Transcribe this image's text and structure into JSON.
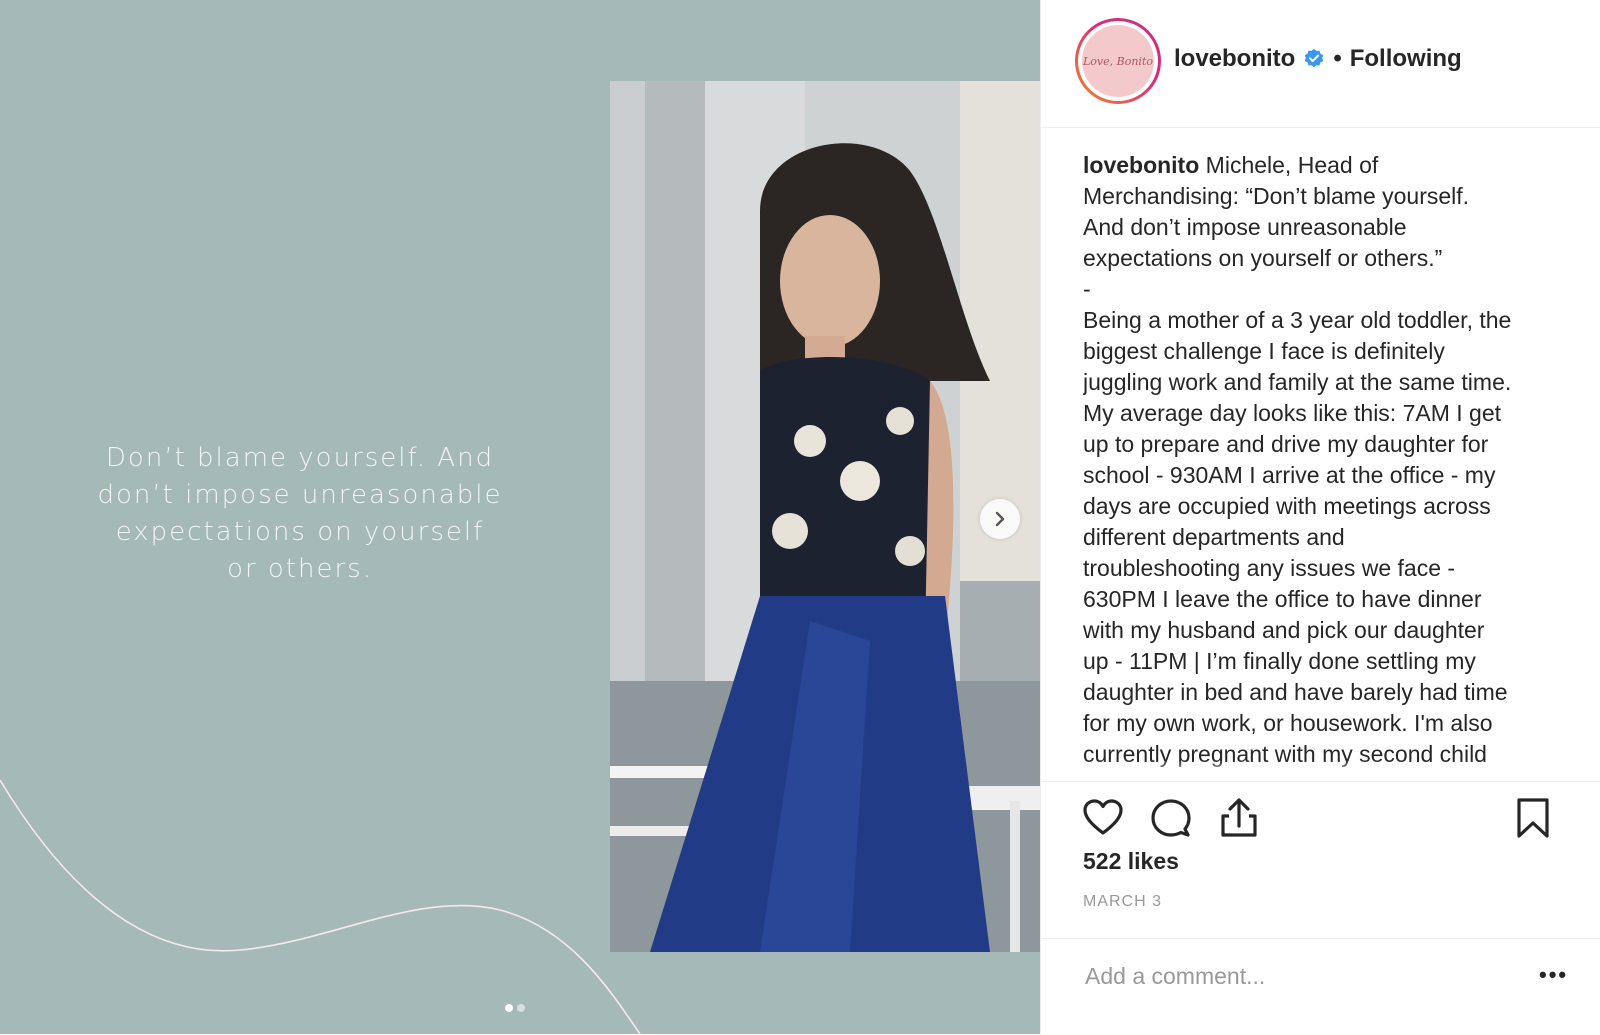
{
  "post": {
    "quote_lines": [
      "Don’t blame yourself. And",
      "don’t impose unreasonable",
      "expectations on yourself",
      "or others."
    ],
    "carousel": {
      "current": 1,
      "total": 2
    }
  },
  "header": {
    "avatar_text": "Love, Bonito",
    "username": "lovebonito",
    "separator": "•",
    "follow_status": "Following"
  },
  "caption": {
    "username": "lovebonito",
    "text": " Michele, Head of\nMerchandising: “Don’t blame yourself.\nAnd don’t impose unreasonable\nexpectations on yourself or others.”\n-\nBeing a mother of a 3 year old toddler, the\nbiggest challenge I face is definitely\njuggling work and family at the same time.\nMy average day looks like this: 7AM I get\nup to prepare and drive my daughter for\nschool - 930AM I arrive at the office - my\ndays are occupied with meetings across\ndifferent departments and\ntroubleshooting any issues we face -\n630PM I leave the office to have dinner\nwith my husband and pick our daughter\nup - 11PM | I’m finally done settling my\ndaughter in bed and have barely had time\nfor my own work, or housework. I'm also\ncurrently pregnant with my second child"
  },
  "stats": {
    "likes": "522 likes",
    "date": "MARCH 3"
  },
  "comment": {
    "placeholder": "Add a comment...",
    "more_label": "•••"
  },
  "icons": {
    "like": "heart-icon",
    "comment": "comment-bubble-icon",
    "share": "share-upload-icon",
    "save": "bookmark-icon",
    "next": "chevron-right-icon",
    "verified": "verified-badge-icon"
  },
  "colors": {
    "background_teal": "#a6b9b9",
    "text_dark": "#262626",
    "text_muted": "#999999",
    "verified_blue": "#3897f0"
  }
}
